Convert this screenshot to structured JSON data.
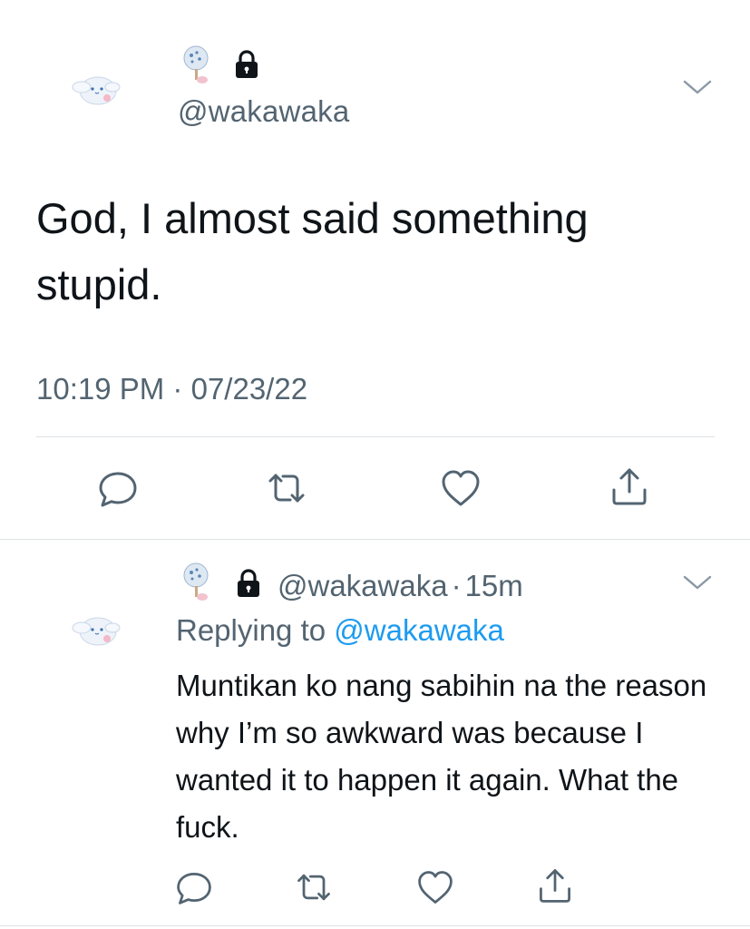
{
  "main_tweet": {
    "handle": "@wakawaka",
    "text": "God, I almost said something stupid.",
    "time": "10:19 PM",
    "separator": "·",
    "date": "07/23/22",
    "icons": {
      "avatar": "cinnamoroll-avatar",
      "mini_icon": "fan-icon",
      "protected": "lock-icon",
      "menu": "chevron-down-icon",
      "reply": "reply-icon",
      "retweet": "retweet-icon",
      "like": "heart-icon",
      "share": "share-icon"
    }
  },
  "reply_tweet": {
    "handle": "@wakawaka",
    "separator": "·",
    "time_ago": "15m",
    "replying_prefix": "Replying to",
    "replying_to": "@wakawaka",
    "text": "Muntikan ko nang sabihin na the reason why I’m so awkward was because I wanted it to happen it again. What the fuck."
  },
  "colors": {
    "text": "#0f1419",
    "secondary": "#536471",
    "mention": "#1d9bf0",
    "divider": "#dde1e4"
  }
}
